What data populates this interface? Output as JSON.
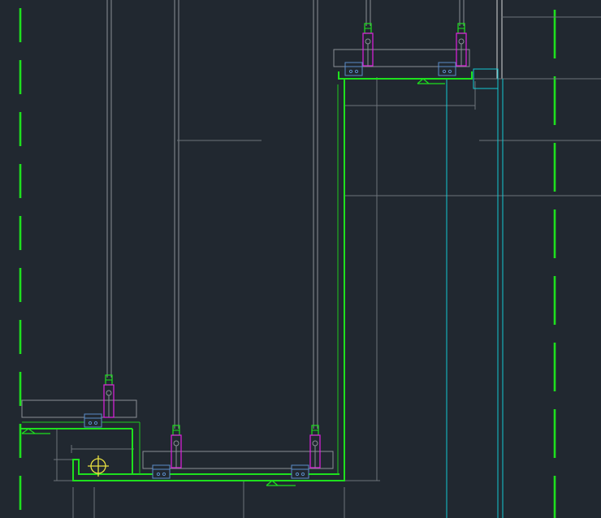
{
  "drawing": {
    "type": "cad-section-detail",
    "colors": {
      "background": "#212830",
      "structure_line": "#1ee01e",
      "hanger_body": "#e020e0",
      "hanger_rod": "#8a8f96",
      "clip": "#5a8cc8",
      "glazing_line": "#14c8d2",
      "extension_line": "#6d737a",
      "snap_marker": "#e8e040"
    },
    "icons": {
      "snap_marker": "crosshair-circle-icon"
    },
    "hanger_count": 5,
    "clip_count": 5,
    "dashed_centerline_count": 2,
    "text_labels": []
  }
}
